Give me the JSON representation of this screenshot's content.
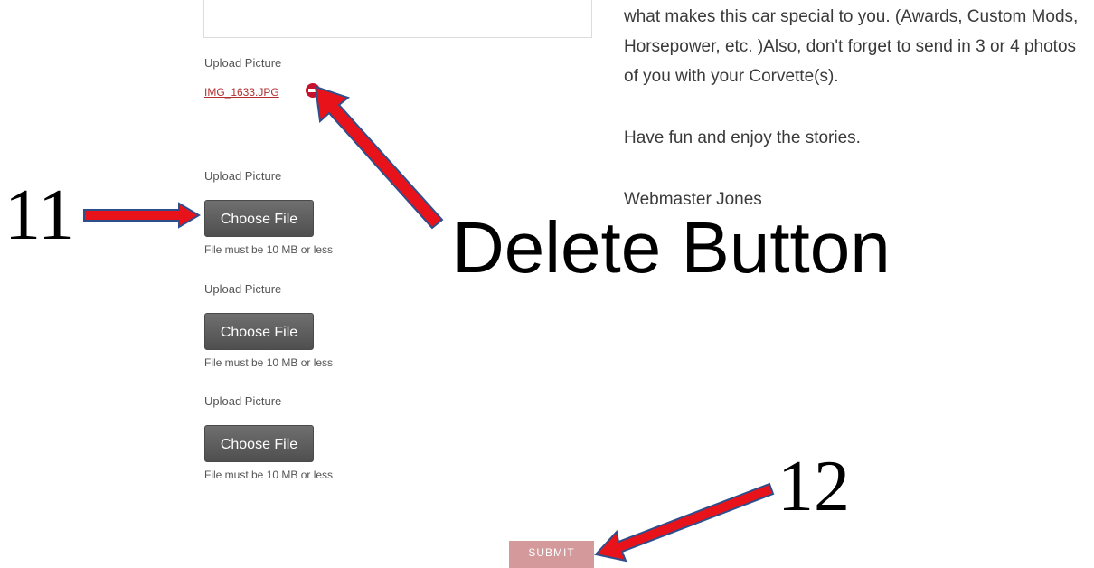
{
  "form": {
    "pictures": [
      {
        "label": "Upload Picture",
        "file_name": "IMG_1633.JPG",
        "delete_icon": "minus-circle-icon"
      },
      {
        "label": "Upload Picture",
        "button_label": "Choose File",
        "note": "File must be 10 MB or less"
      },
      {
        "label": "Upload Picture",
        "button_label": "Choose File",
        "note": "File must be 10 MB or less"
      },
      {
        "label": "Upload Picture",
        "button_label": "Choose File",
        "note": "File must be 10 MB or less"
      }
    ],
    "submit_label": "SUBMIT"
  },
  "info": {
    "paragraph1": "what makes this car special to you. (Awards, Custom Mods, Horsepower,  etc. )Also, don't forget to send in 3 or 4 photos of you with your Corvette(s).",
    "paragraph2": "Have fun and enjoy the stories.",
    "signature": "Webmaster Jones"
  },
  "annotations": {
    "label_11": "11",
    "label_12": "12",
    "delete_callout": "Delete Button"
  },
  "colors": {
    "link": "#b03030",
    "delete_icon": "#c8102e",
    "choose_button": "#5f5f5f",
    "submit_button": "#d4999a",
    "arrow_fill": "#e8131a",
    "arrow_stroke": "#2e4f8c"
  }
}
